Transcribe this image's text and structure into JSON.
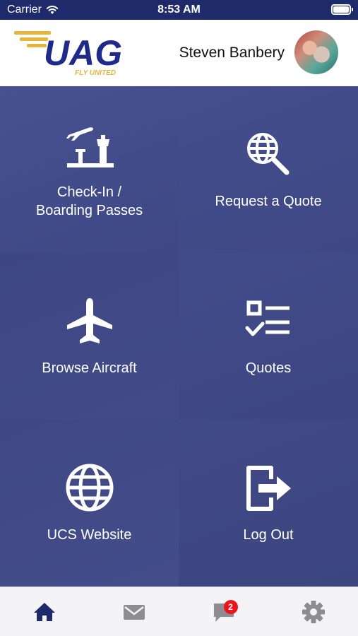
{
  "status_bar": {
    "carrier": "Carrier",
    "time": "8:53 AM"
  },
  "header": {
    "logo_text": "UAG",
    "logo_tagline": "FLY UNITED",
    "user_name": "Steven Banbery"
  },
  "tiles": [
    {
      "label": "Check-In /\nBoarding Passes",
      "icon": "departure-tower-icon"
    },
    {
      "label": "Request a Quote",
      "icon": "globe-search-icon"
    },
    {
      "label": "Browse Aircraft",
      "icon": "airplane-icon"
    },
    {
      "label": "Quotes",
      "icon": "checklist-icon"
    },
    {
      "label": "UCS Website",
      "icon": "globe-icon"
    },
    {
      "label": "Log Out",
      "icon": "logout-icon"
    }
  ],
  "tabbar": {
    "items": [
      {
        "name": "home",
        "icon": "home-icon"
      },
      {
        "name": "mail",
        "icon": "mail-icon"
      },
      {
        "name": "chat",
        "icon": "chat-icon",
        "badge": "2"
      },
      {
        "name": "settings",
        "icon": "gear-icon"
      }
    ]
  },
  "colors": {
    "brand_navy": "#1f2a6b",
    "tile_blue": "#414a87",
    "logo_gold": "#e7b53b",
    "badge_red": "#e8161c"
  }
}
